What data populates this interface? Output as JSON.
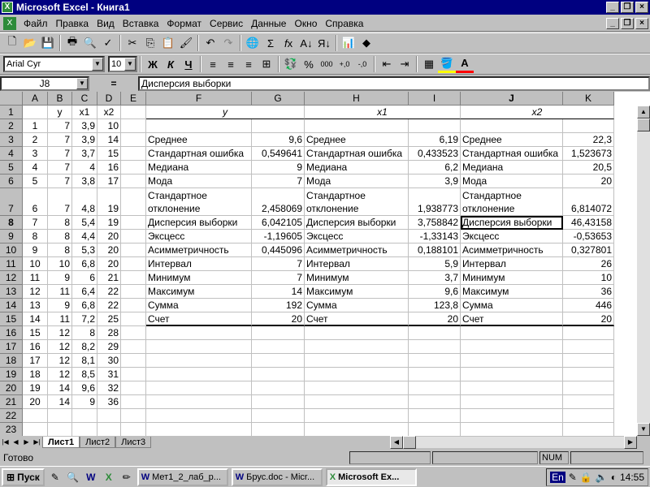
{
  "app": {
    "title": "Microsoft Excel - Книга1"
  },
  "menu": [
    "Файл",
    "Правка",
    "Вид",
    "Вставка",
    "Формат",
    "Сервис",
    "Данные",
    "Окно",
    "Справка"
  ],
  "font": {
    "name": "Arial Cyr",
    "size": "10"
  },
  "formula": {
    "cell_ref": "J8",
    "eq": "=",
    "content": "Дисперсия выборки"
  },
  "columns": [
    "A",
    "B",
    "C",
    "D",
    "E",
    "F",
    "G",
    "H",
    "I",
    "J",
    "K"
  ],
  "rows": [
    "1",
    "2",
    "3",
    "4",
    "5",
    "6",
    "7",
    "8",
    "9",
    "10",
    "11",
    "12",
    "13",
    "14",
    "15",
    "16",
    "17",
    "18",
    "19",
    "20",
    "21",
    "22",
    "23"
  ],
  "data": {
    "A": [
      "",
      "1",
      "2",
      "3",
      "4",
      "5",
      "6",
      "7",
      "8",
      "9",
      "10",
      "11",
      "12",
      "13",
      "14",
      "15",
      "16",
      "17",
      "18",
      "19",
      "20"
    ],
    "B": [
      "y",
      "7",
      "7",
      "7",
      "7",
      "7",
      "7",
      "8",
      "8",
      "8",
      "10",
      "9",
      "11",
      "9",
      "11",
      "12",
      "12",
      "12",
      "12",
      "14",
      "14"
    ],
    "C": [
      "x1",
      "3,9",
      "3,9",
      "3,7",
      "4",
      "3,8",
      "4,8",
      "5,4",
      "4,4",
      "5,3",
      "6,8",
      "6",
      "6,4",
      "6,8",
      "7,2",
      "8",
      "8,2",
      "8,1",
      "8,5",
      "9,6",
      "9"
    ],
    "D": [
      "x2",
      "10",
      "14",
      "15",
      "16",
      "17",
      "19",
      "19",
      "20",
      "20",
      "20",
      "21",
      "22",
      "22",
      "25",
      "28",
      "29",
      "30",
      "31",
      "32",
      "36"
    ]
  },
  "stats_labels": [
    "Среднее",
    "Стандартная ошибка",
    "Медиана",
    "Мода",
    "Стандартное отклонение",
    "Дисперсия выборки",
    "Эксцесс",
    "Асимметричность",
    "Интервал",
    "Минимум",
    "Максимум",
    "Сумма",
    "Счет"
  ],
  "stats_labels_split": {
    "line1": "Стандартное",
    "line2": " отклонение"
  },
  "stats": {
    "y": {
      "header": "y",
      "values": [
        "9,6",
        "0,549641",
        "9",
        "7",
        "2,458069",
        "6,042105",
        "-1,19605",
        "0,445096",
        "7",
        "7",
        "14",
        "192",
        "20"
      ]
    },
    "x1": {
      "header": "x1",
      "values": [
        "6,19",
        "0,433523",
        "6,2",
        "3,9",
        "1,938773",
        "3,758842",
        "-1,33143",
        "0,188101",
        "5,9",
        "3,7",
        "9,6",
        "123,8",
        "20"
      ]
    },
    "x2": {
      "header": "x2",
      "values": [
        "22,3",
        "1,523673",
        "20,5",
        "20",
        "6,814072",
        "46,43158",
        "-0,53653",
        "0,327801",
        "26",
        "10",
        "36",
        "446",
        "20"
      ]
    }
  },
  "sheets": [
    "Лист1",
    "Лист2",
    "Лист3"
  ],
  "status": {
    "text": "Готово",
    "num": "NUM"
  },
  "taskbar": {
    "start": "Пуск",
    "items": [
      "Мет1_2_лаб_р...",
      "Брус.doc - Micr...",
      "Microsoft Ex..."
    ],
    "lang": "En",
    "time": "14:55"
  }
}
